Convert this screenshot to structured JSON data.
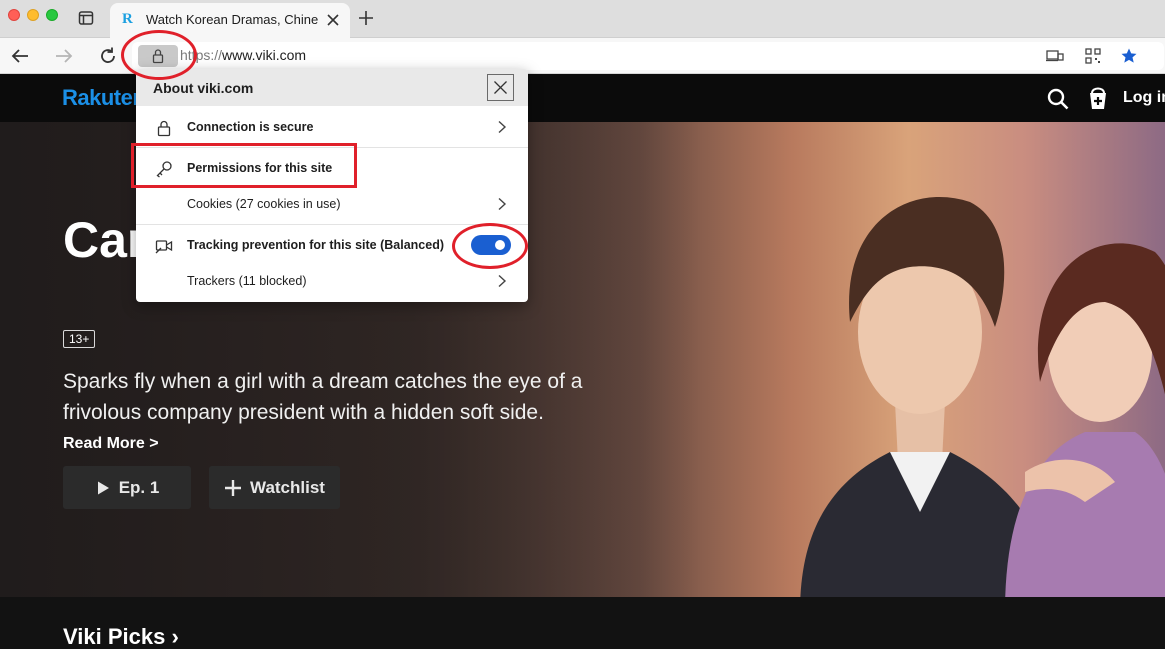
{
  "browser": {
    "tab": {
      "favicon_letter": "R",
      "title": "Watch Korean Dramas, Chinese Dramas and Movies Online"
    },
    "url": {
      "scheme": "https://",
      "host": "www.viki.com"
    }
  },
  "site": {
    "logo": "Rakuten",
    "login_label": "Log in",
    "hero": {
      "title": "Cam Love",
      "rating": "13+",
      "description": "Sparks fly when a girl with a dream catches the eye of a frivolous company president with a hidden soft side.",
      "read_more": "Read More >",
      "episode_button": "Ep. 1",
      "watchlist_button": "Watchlist"
    },
    "picks_title": "Viki Picks ›"
  },
  "popup": {
    "title": "About viki.com",
    "connection": "Connection is secure",
    "permissions": "Permissions for this site",
    "cookies": "Cookies (27 cookies in use)",
    "tracking": "Tracking prevention for this site (Balanced)",
    "trackers": "Trackers (11 blocked)",
    "tracking_enabled": true
  },
  "colors": {
    "accent": "#1a5fd1",
    "annotation": "#e0202a",
    "brand": "#1b8fe6"
  },
  "icons": [
    "lock-icon",
    "key-icon",
    "tracking-icon",
    "chevron-right-icon",
    "close-icon",
    "search-icon",
    "star-icon"
  ]
}
